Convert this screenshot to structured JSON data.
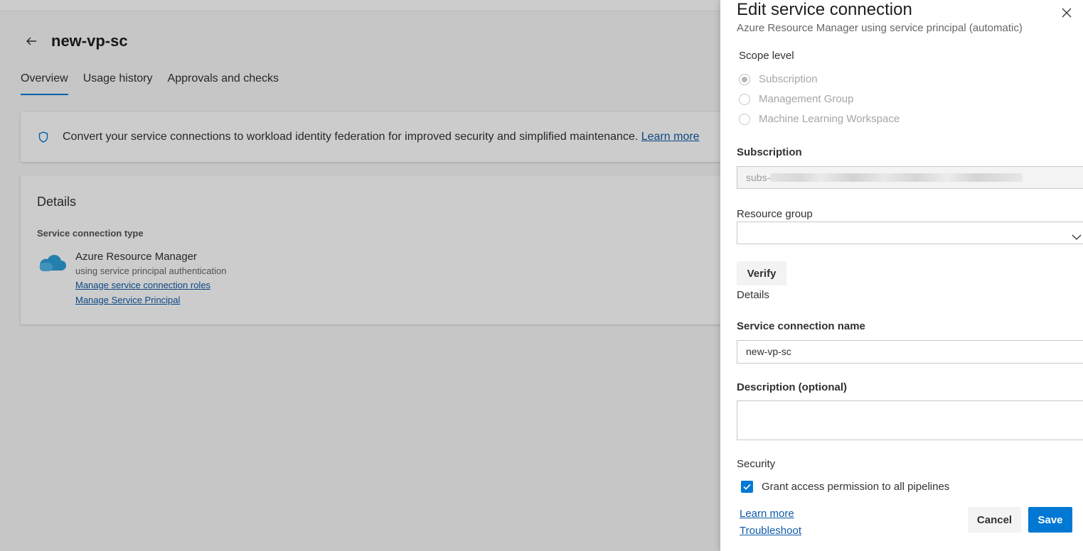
{
  "page": {
    "title": "new-vp-sc",
    "tabs": [
      "Overview",
      "Usage history",
      "Approvals and checks"
    ],
    "banner": {
      "message": "Convert your service connections to workload identity federation for improved security and simplified maintenance.",
      "link": "Learn more"
    },
    "details": {
      "heading": "Details",
      "type_label": "Service connection type",
      "type_name": "Azure Resource Manager",
      "type_sub": "using service principal authentication",
      "link_roles": "Manage service connection roles",
      "link_principal": "Manage Service Principal"
    }
  },
  "panel": {
    "title": "Edit service connection",
    "subtitle": "Azure Resource Manager using service principal (automatic)",
    "scope_label": "Scope level",
    "scope_options": [
      "Subscription",
      "Management Group",
      "Machine Learning Workspace"
    ],
    "scope_selected": "Subscription",
    "subscription_label": "Subscription",
    "subscription_value": "subs-",
    "resource_group_label": "Resource group",
    "resource_group_value": "",
    "verify_label": "Verify",
    "details_label": "Details",
    "name_label": "Service connection name",
    "name_value": "new-vp-sc",
    "description_label": "Description (optional)",
    "description_value": "",
    "security_label": "Security",
    "grant_label": "Grant access permission to all pipelines",
    "grant_checked": true,
    "learn_more": "Learn more",
    "troubleshoot": "Troubleshoot",
    "cancel": "Cancel",
    "save": "Save"
  },
  "colors": {
    "accent": "#0078d4",
    "link": "#0f5ba7"
  },
  "icons": [
    "back-arrow-icon",
    "shield-icon",
    "cloud-icon",
    "close-icon",
    "chevron-down-icon",
    "checkmark-icon"
  ]
}
